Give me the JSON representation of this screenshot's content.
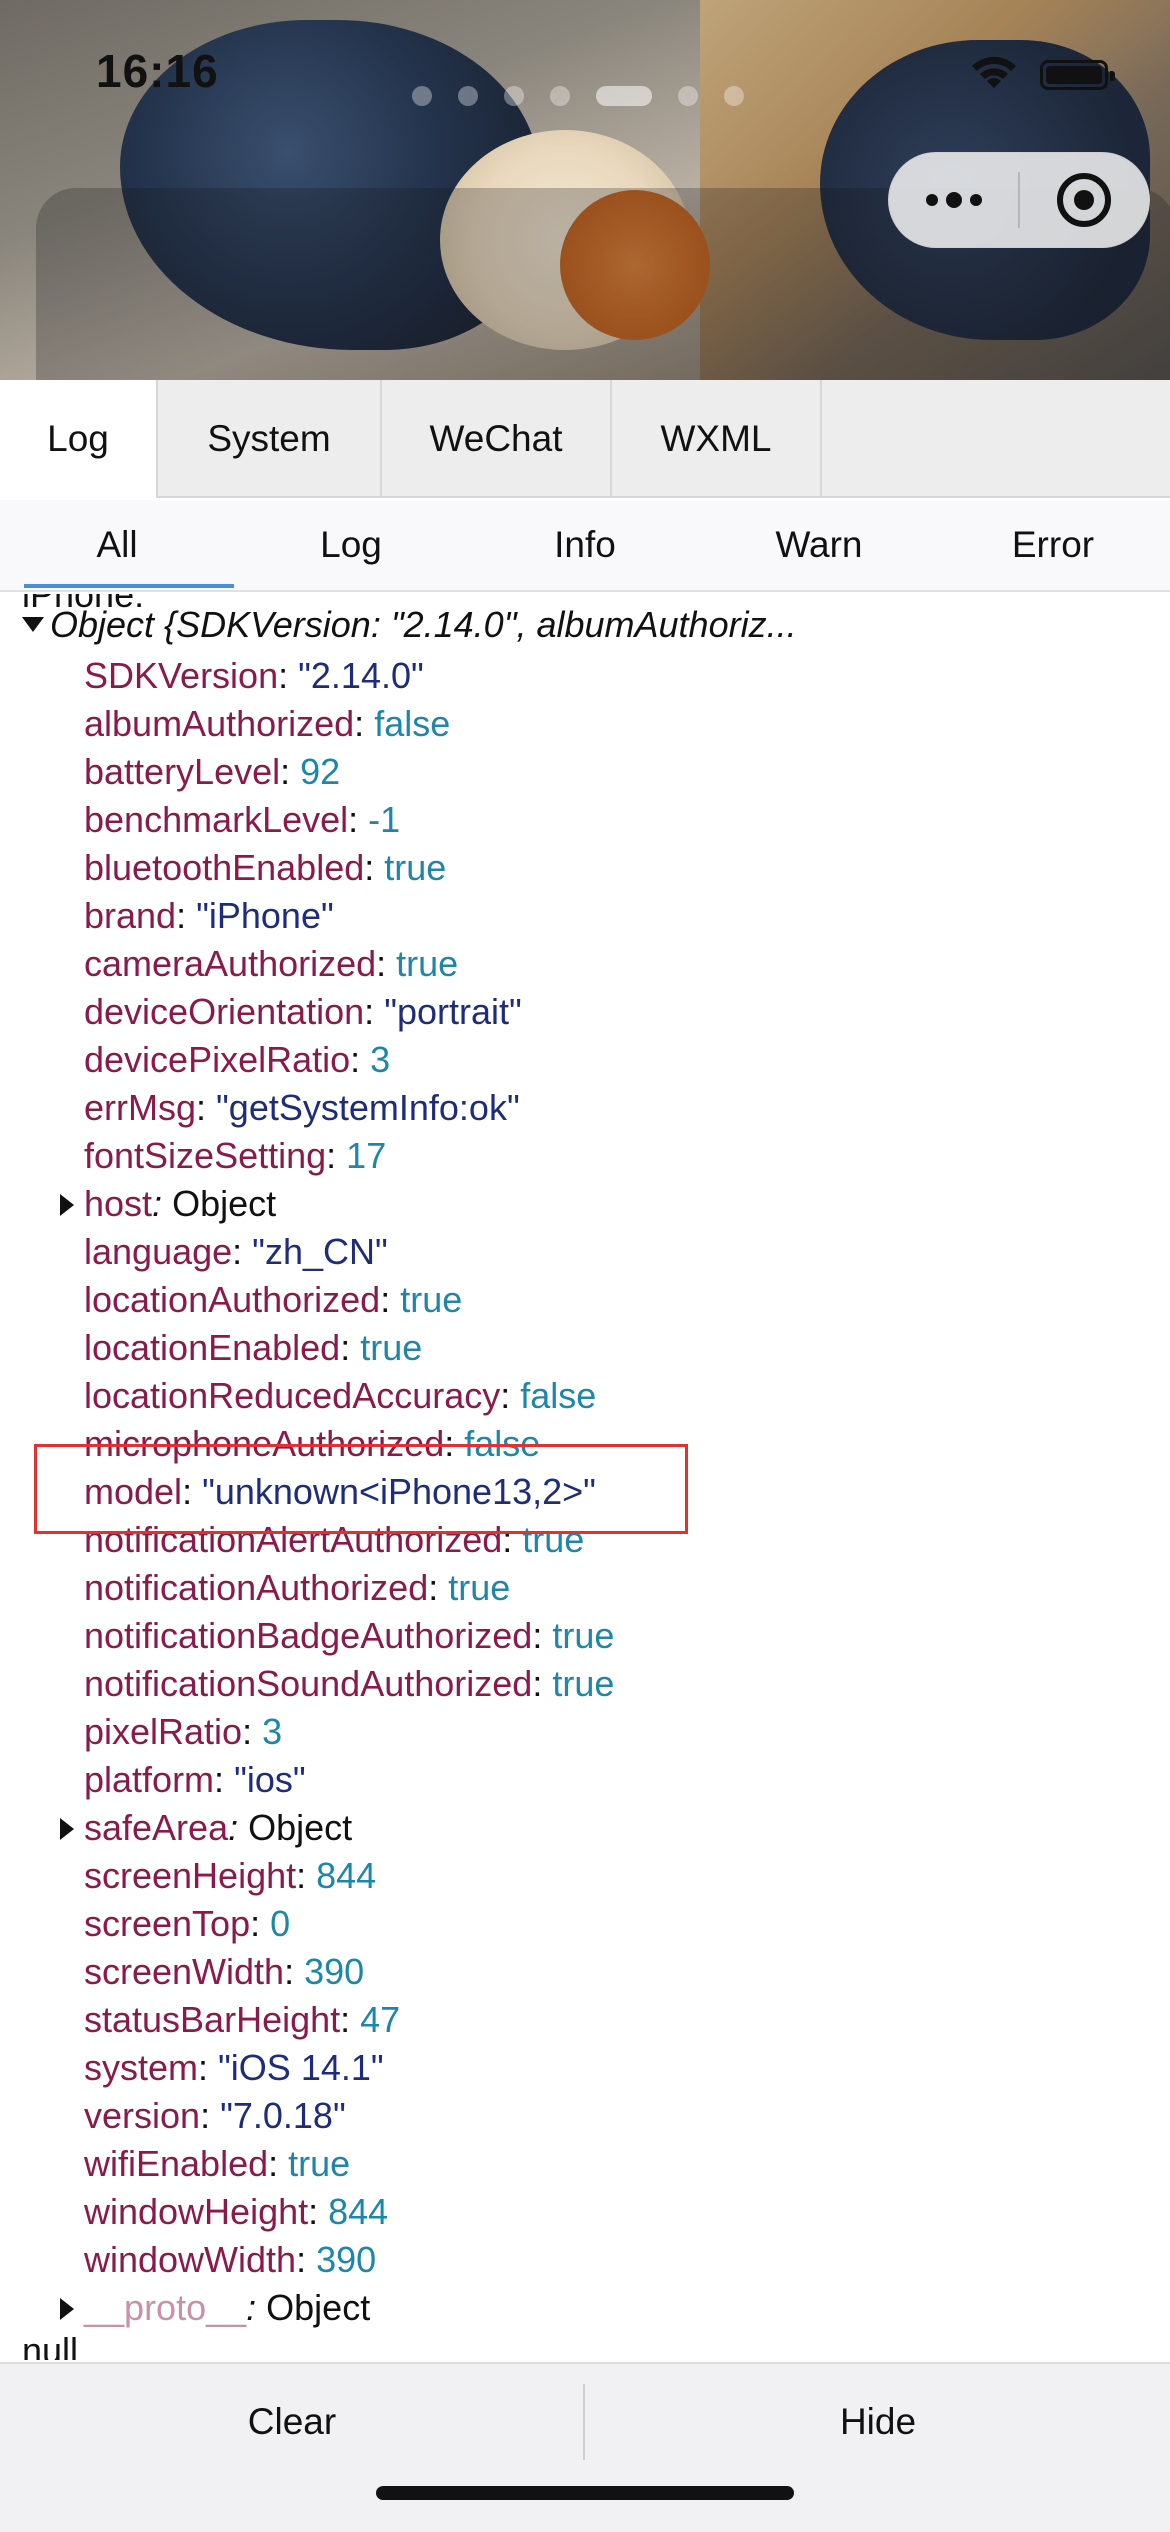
{
  "status_bar": {
    "time": "16:16",
    "wifi_icon": "wifi-icon",
    "battery_icon": "battery-icon"
  },
  "capsule": {
    "more_icon": "more-dots-icon",
    "close_icon": "target-close-icon"
  },
  "main_tabs": [
    {
      "label": "Log",
      "active": true
    },
    {
      "label": "System",
      "active": false
    },
    {
      "label": "WeChat",
      "active": false
    },
    {
      "label": "WXML",
      "active": false
    }
  ],
  "filter_tabs": [
    {
      "label": "All",
      "active": true
    },
    {
      "label": "Log",
      "active": false
    },
    {
      "label": "Info",
      "active": false
    },
    {
      "label": "Warn",
      "active": false
    },
    {
      "label": "Error",
      "active": false
    }
  ],
  "log": {
    "cut_top_text": "iPhone: ",
    "object_header": "Object {SDKVersion: \"2.14.0\", albumAuthoriz...",
    "entries": [
      {
        "key": "SDKVersion",
        "sep": ": ",
        "value": "\"2.14.0\"",
        "kind": "str"
      },
      {
        "key": "albumAuthorized",
        "sep": ": ",
        "value": "false",
        "kind": "lit"
      },
      {
        "key": "batteryLevel",
        "sep": ": ",
        "value": "92",
        "kind": "lit"
      },
      {
        "key": "benchmarkLevel",
        "sep": ": ",
        "value": "-1",
        "kind": "lit"
      },
      {
        "key": "bluetoothEnabled",
        "sep": ": ",
        "value": "true",
        "kind": "lit"
      },
      {
        "key": "brand",
        "sep": ": ",
        "value": "\"iPhone\"",
        "kind": "str"
      },
      {
        "key": "cameraAuthorized",
        "sep": ": ",
        "value": "true",
        "kind": "lit"
      },
      {
        "key": "deviceOrientation",
        "sep": ": ",
        "value": "\"portrait\"",
        "kind": "str"
      },
      {
        "key": "devicePixelRatio",
        "sep": ": ",
        "value": "3",
        "kind": "lit"
      },
      {
        "key": "errMsg",
        "sep": ": ",
        "value": "\"getSystemInfo:ok\"",
        "kind": "str"
      },
      {
        "key": "fontSizeSetting",
        "sep": ": ",
        "value": "17",
        "kind": "lit"
      },
      {
        "key": "host",
        "sep": ": ",
        "value": "Object",
        "kind": "obj",
        "expandable": true
      },
      {
        "key": "language",
        "sep": ": ",
        "value": "\"zh_CN\"",
        "kind": "str"
      },
      {
        "key": "locationAuthorized",
        "sep": ": ",
        "value": "true",
        "kind": "lit"
      },
      {
        "key": "locationEnabled",
        "sep": ": ",
        "value": "true",
        "kind": "lit"
      },
      {
        "key": "locationReducedAccuracy",
        "sep": ": ",
        "value": "false",
        "kind": "lit"
      },
      {
        "key": "microphoneAuthorized",
        "sep": ": ",
        "value": "false",
        "kind": "lit"
      },
      {
        "key": "model",
        "sep": ": ",
        "value": "\"unknown<iPhone13,2>\"",
        "kind": "str",
        "highlighted": true
      },
      {
        "key": "notificationAlertAuthorized",
        "sep": ": ",
        "value": "true",
        "kind": "lit"
      },
      {
        "key": "notificationAuthorized",
        "sep": ": ",
        "value": "true",
        "kind": "lit"
      },
      {
        "key": "notificationBadgeAuthorized",
        "sep": ": ",
        "value": "true",
        "kind": "lit"
      },
      {
        "key": "notificationSoundAuthorized",
        "sep": ": ",
        "value": "true",
        "kind": "lit"
      },
      {
        "key": "pixelRatio",
        "sep": ": ",
        "value": "3",
        "kind": "lit"
      },
      {
        "key": "platform",
        "sep": ": ",
        "value": "\"ios\"",
        "kind": "str"
      },
      {
        "key": "safeArea",
        "sep": ": ",
        "value": "Object",
        "kind": "obj",
        "expandable": true
      },
      {
        "key": "screenHeight",
        "sep": ": ",
        "value": "844",
        "kind": "lit"
      },
      {
        "key": "screenTop",
        "sep": ": ",
        "value": "0",
        "kind": "lit"
      },
      {
        "key": "screenWidth",
        "sep": ": ",
        "value": "390",
        "kind": "lit"
      },
      {
        "key": "statusBarHeight",
        "sep": ": ",
        "value": "47",
        "kind": "lit"
      },
      {
        "key": "system",
        "sep": ": ",
        "value": "\"iOS 14.1\"",
        "kind": "str"
      },
      {
        "key": "version",
        "sep": ": ",
        "value": "\"7.0.18\"",
        "kind": "str"
      },
      {
        "key": "wifiEnabled",
        "sep": ": ",
        "value": "true",
        "kind": "lit"
      },
      {
        "key": "windowHeight",
        "sep": ": ",
        "value": "844",
        "kind": "lit"
      },
      {
        "key": "windowWidth",
        "sep": ": ",
        "value": "390",
        "kind": "lit"
      },
      {
        "key": "__proto__",
        "sep": ": ",
        "value": "Object",
        "kind": "obj",
        "expandable": true,
        "proto": true
      }
    ],
    "cut_bottom_text": "null"
  },
  "toolbar": {
    "clear_label": "Clear",
    "hide_label": "Hide"
  },
  "colors": {
    "key": "#8a1a4a",
    "string_value": "#1f2c7a",
    "literal_value": "#1c87a8",
    "highlight_border": "#e0322f",
    "active_filter_underline": "#4a8fd6"
  }
}
